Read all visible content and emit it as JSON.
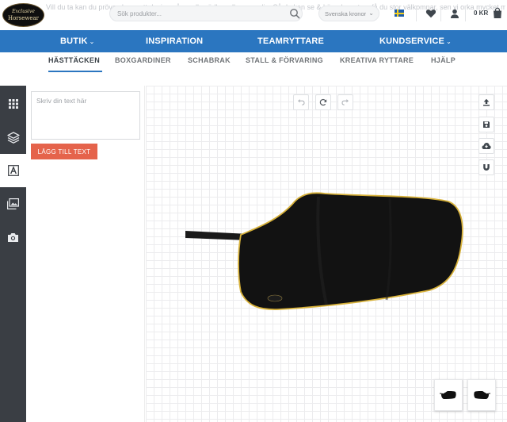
{
  "header": {
    "background_text": "Vill du ta kan du pröva skapa ett design på scrolls vädher eller vara din. Så du kan se & köp. dessutom få du stor välkomnar, sen vi orka mycket mer kan också det med var gästa ”DESIGNA SJÄLV”",
    "logo_line1": "Exclusive",
    "logo_line2": "Horsewear",
    "search_placeholder": "Sök produkter...",
    "currency": "Svenska kronor",
    "cart_amount": "0 KR"
  },
  "main_nav": [
    {
      "label": "BUTIK",
      "dropdown": true
    },
    {
      "label": "INSPIRATION",
      "dropdown": false
    },
    {
      "label": "TEAMRYTTARE",
      "dropdown": false
    },
    {
      "label": "KUNDSERVICE",
      "dropdown": true
    }
  ],
  "sub_nav": [
    "HÄSTTÄCKEN",
    "BOXGARDINER",
    "SCHABRAK",
    "STALL & FÖRVARING",
    "KREATIVA RYTTARE",
    "HJÄLP"
  ],
  "sub_nav_active": "HÄSTTÄCKEN",
  "tools": [
    "grid-icon",
    "layers-icon",
    "text-icon",
    "image-icon",
    "camera-icon"
  ],
  "active_tool": "text-icon",
  "text_panel": {
    "placeholder": "Skriv din text här",
    "add_button": "LÄGG TILL TEXT"
  },
  "canvas_tools": {
    "top": [
      "undo-icon",
      "reset-icon",
      "redo-icon"
    ],
    "right": [
      "upload-icon",
      "save-icon",
      "cloud-download-icon",
      "magnet-icon"
    ]
  },
  "colors": {
    "brand_blue": "#2b76c0",
    "accent_red": "#e5634b",
    "rail_dark": "#3a3e44",
    "rug_black": "#121212",
    "rug_trim": "#d7b13a"
  }
}
